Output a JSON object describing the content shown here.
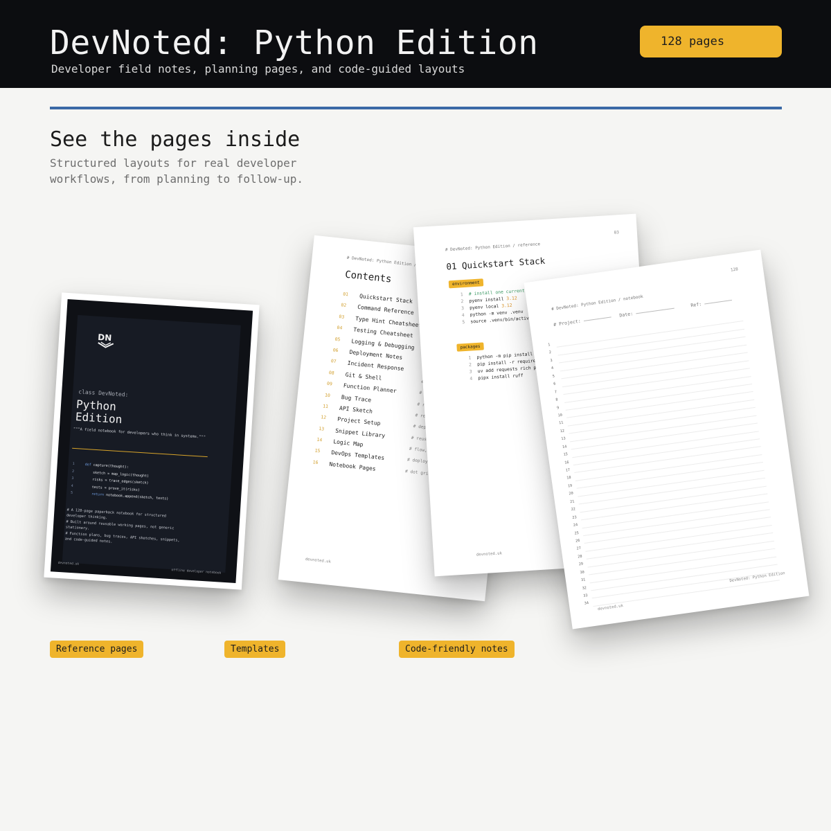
{
  "header": {
    "title": "DevNoted: Python Edition",
    "subtitle": "Developer field notes, planning pages, and code-guided layouts",
    "pages_badge": "128 pages"
  },
  "section": {
    "title": "See the pages inside",
    "description": "Structured layouts for real developer workflows, from planning to follow-up."
  },
  "cover": {
    "logo_text": "DN",
    "class_line": "class DevNoted:",
    "name_line1": "Python",
    "name_line2": "Edition",
    "quote": "\"\"\"A field notebook for developers who think in systems.\"\"\"",
    "code": [
      {
        "n": "1",
        "text": "def capture(thought):"
      },
      {
        "n": "2",
        "text": "    sketch = map_logic(thought)"
      },
      {
        "n": "3",
        "text": "    risks = trace_edges(sketch)"
      },
      {
        "n": "4",
        "text": "    tests = prove_it(risks)"
      },
      {
        "n": "5",
        "text": "    return notebook.append(sketch, tests)"
      }
    ],
    "notes": [
      "# A 128-page paperback notebook for structured developer thinking.",
      "# Built around reusable working pages, not generic stationery.",
      "# Function plans, bug traces, API sketches, snippets, and code-guided notes."
    ],
    "url": "devnoted.uk",
    "tagline": "offline developer notebook"
  },
  "contents": {
    "crumb": "# DevNoted: Python Edition / contents",
    "title": "Contents",
    "items": [
      {
        "num": "01",
        "label": "Quickstart Stack",
        "note": ""
      },
      {
        "num": "02",
        "label": "Command Reference",
        "note": ""
      },
      {
        "num": "03",
        "label": "Type Hint Cheatsheet",
        "note": "#"
      },
      {
        "num": "04",
        "label": "Testing Cheatsheet",
        "note": "#"
      },
      {
        "num": "05",
        "label": "Logging & Debugging",
        "note": "#"
      },
      {
        "num": "06",
        "label": "Deployment Notes",
        "note": "# s"
      },
      {
        "num": "07",
        "label": "Incident Response",
        "note": "# t"
      },
      {
        "num": "08",
        "label": "Git & Shell",
        "note": "# sm"
      },
      {
        "num": "09",
        "label": "Function Planner",
        "note": "# in"
      },
      {
        "num": "10",
        "label": "Bug Trace",
        "note": "# repr"
      },
      {
        "num": "11",
        "label": "API Sketch",
        "note": "# reque"
      },
      {
        "num": "12",
        "label": "Project Setup",
        "note": "# depen"
      },
      {
        "num": "13",
        "label": "Snippet Library",
        "note": "# reusab"
      },
      {
        "num": "14",
        "label": "Logic Map",
        "note": "# flow, i"
      },
      {
        "num": "15",
        "label": "DevOps Templates",
        "note": "# deploy"
      },
      {
        "num": "16",
        "label": "Notebook Pages",
        "note": "# dot grid"
      }
    ],
    "url": "devnoted.uk"
  },
  "reference": {
    "crumb": "# DevNoted: Python Edition / reference",
    "page_number": "03",
    "title": "01 Quickstart Stack",
    "environment_label": "environment",
    "environment_code": [
      {
        "n": "1",
        "text": "# install one current Python",
        "kind": "comment"
      },
      {
        "n": "2",
        "text": "pyenv install ",
        "num": "3.12"
      },
      {
        "n": "3",
        "text": "pyenv local ",
        "num": "3.12"
      },
      {
        "n": "4",
        "text": "python -m venv .venv"
      },
      {
        "n": "5",
        "text": "source .venv/bin/activate"
      }
    ],
    "packages_label": "packages",
    "packages_code": [
      {
        "n": "1",
        "text": "python -m pip install --upgrade pip"
      },
      {
        "n": "2",
        "text": "pip install -r requirements.txt"
      },
      {
        "n": "3",
        "text": "uv add requests rich pytest"
      },
      {
        "n": "4",
        "text": "pipx install ruff"
      }
    ],
    "url": "devnoted.uk"
  },
  "notebook": {
    "crumb": "# DevNoted: Python Edition / notebook",
    "page_number": "128",
    "project_label": "# Project:",
    "date_label": "Date:",
    "ref_label": "Ref:",
    "line_count": 34,
    "footer": "DevNoted: Python Edition",
    "url": "devnoted.uk"
  },
  "tags": [
    "Reference pages",
    "Templates",
    "Code-friendly notes"
  ],
  "colors": {
    "header_bg": "#0c0d10",
    "accent_yellow": "#efb42c",
    "rule_blue": "#3a69a6",
    "background": "#f5f5f3"
  }
}
